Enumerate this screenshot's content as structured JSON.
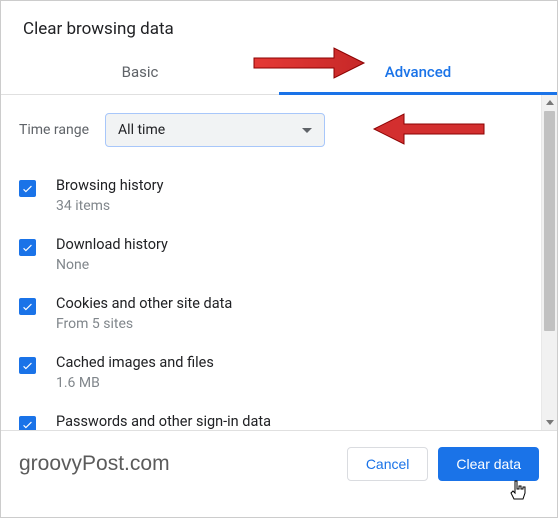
{
  "dialog": {
    "title": "Clear browsing data"
  },
  "tabs": {
    "basic": "Basic",
    "advanced": "Advanced"
  },
  "time": {
    "label": "Time range",
    "value": "All time"
  },
  "items": [
    {
      "title": "Browsing history",
      "sub": "34 items"
    },
    {
      "title": "Download history",
      "sub": "None"
    },
    {
      "title": "Cookies and other site data",
      "sub": "From 5 sites"
    },
    {
      "title": "Cached images and files",
      "sub": "1.6 MB"
    },
    {
      "title": "Passwords and other sign-in data",
      "sub": ""
    }
  ],
  "buttons": {
    "cancel": "Cancel",
    "clear": "Clear data"
  },
  "watermark": "groovyPost.com"
}
